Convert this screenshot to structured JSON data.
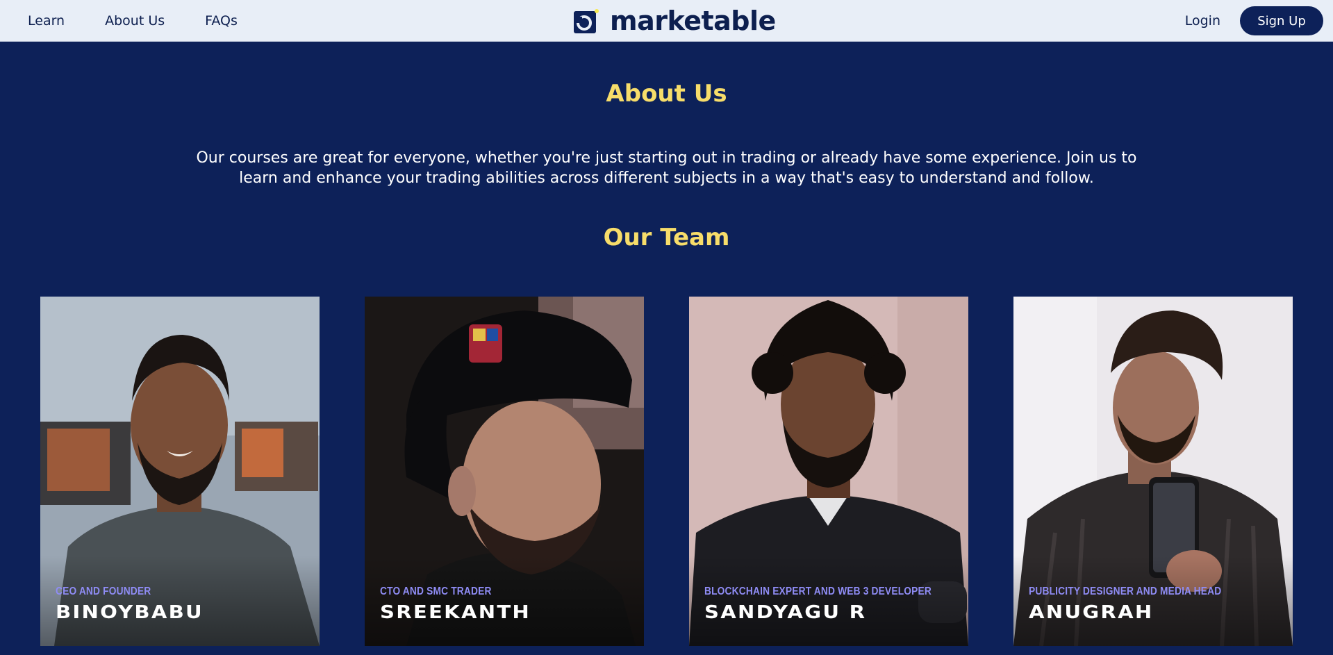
{
  "nav": {
    "links": [
      "Learn",
      "About Us",
      "FAQs"
    ],
    "logo_text": "marketable",
    "login_label": "Login",
    "signup_label": "Sign Up"
  },
  "about": {
    "title": "About Us",
    "description": "Our courses are great for everyone, whether you're just starting out in  trading or already have some experience. Join us to\nlearn and enhance  your trading abilities across different subjects in a way that's easy to understand and follow."
  },
  "team": {
    "title": "Our Team",
    "members": [
      {
        "role": "CEO AND FOUNDER",
        "name": "BINOYBABU"
      },
      {
        "role": "CTO AND SMC TRADER",
        "name": "SREEKANTH"
      },
      {
        "role": "BLOCKCHAIN EXPERT AND WEB 3 DEVELOPER",
        "name": "SANDYAGU R"
      },
      {
        "role": "PUBLICITY DESIGNER AND MEDIA HEAD",
        "name": "ANUGRAH"
      }
    ]
  },
  "colors": {
    "page_background": "#0d2159",
    "nav_background": "#e8eef7",
    "heading_yellow": "#f7dd6a",
    "role_purple": "#8f8cf5",
    "logo_accent": "#f7e94f"
  },
  "icons": [
    "marketable-logo-icon"
  ]
}
